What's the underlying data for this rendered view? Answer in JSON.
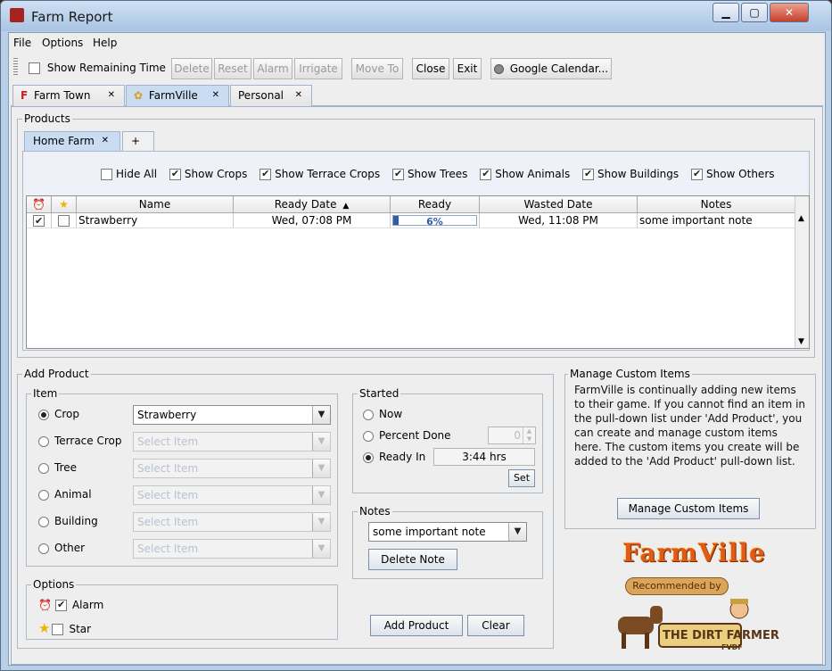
{
  "window": {
    "title": "Farm Report"
  },
  "menu": [
    "File",
    "Options",
    "Help"
  ],
  "toolbar": {
    "show_remaining_time": "Show Remaining Time",
    "buttons": [
      "Delete",
      "Reset",
      "Alarm",
      "Irrigate",
      "Move To",
      "Close",
      "Exit"
    ],
    "google_calendar": "Google Calendar..."
  },
  "farm_tabs": [
    "Farm Town",
    "FarmVille",
    "Personal"
  ],
  "products": {
    "title": "Products",
    "tabs": [
      "Home Farm",
      "+"
    ],
    "filters": [
      "Hide All",
      "Show Crops",
      "Show Terrace Crops",
      "Show Trees",
      "Show Animals",
      "Show Buildings",
      "Show Others"
    ],
    "columns": [
      "Name",
      "Ready Date",
      "Ready",
      "Wasted Date",
      "Notes"
    ],
    "sort_indicator": "▲",
    "rows": [
      {
        "name": "Strawberry",
        "ready_date": "Wed, 07:08 PM",
        "ready_pct": 6,
        "ready_text": "6%",
        "wasted_date": "Wed, 11:08 PM",
        "notes": "some important note",
        "alarm": true,
        "star": false
      }
    ]
  },
  "add_product": {
    "title": "Add Product",
    "item_title": "Item",
    "item_types": [
      "Crop",
      "Terrace Crop",
      "Tree",
      "Animal",
      "Building",
      "Other"
    ],
    "crop_value": "Strawberry",
    "select_placeholder": "Select Item",
    "started_title": "Started",
    "started_options": [
      "Now",
      "Percent Done",
      "Ready In"
    ],
    "percent_value": "0",
    "ready_in_value": "3:44 hrs",
    "set_label": "Set",
    "notes_title": "Notes",
    "notes_value": "some important note",
    "delete_note": "Delete Note",
    "options_title": "Options",
    "alarm_label": "Alarm",
    "star_label": "Star",
    "add_button": "Add Product",
    "clear_button": "Clear"
  },
  "custom_items": {
    "title": "Manage Custom Items",
    "description": "FarmVille is continually adding new items to their game. If you cannot find an item in the pull-down list under 'Add Product', you can create and manage custom items here. The custom items you create will be added to the 'Add Product' pull-down list.",
    "button": "Manage Custom Items"
  },
  "logos": {
    "farmville": "FarmVille",
    "recommended_by": "Recommended by",
    "dirt_farmer": "THE DIRT FARMER",
    "fvdf": "FVDF"
  }
}
